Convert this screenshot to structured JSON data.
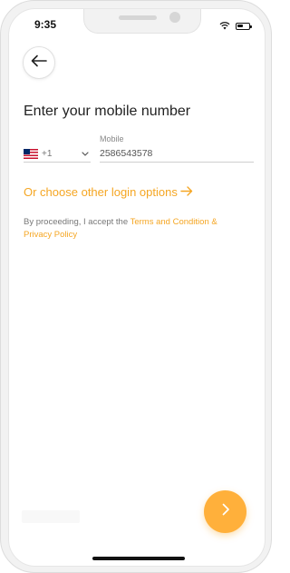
{
  "status_bar": {
    "time": "9:35"
  },
  "header": {
    "back_icon": "arrow-left-icon"
  },
  "form": {
    "title": "Enter your mobile number",
    "country": {
      "flag": "us-flag",
      "code": "+1"
    },
    "mobile": {
      "label": "Mobile",
      "value": "2586543578"
    }
  },
  "links": {
    "other_login": "Or choose other login options"
  },
  "terms": {
    "prefix": "By proceeding, I accept the ",
    "link": "Terms and Condition & Privacy Policy"
  },
  "footer": {
    "next_icon": "chevron-right-icon"
  },
  "colors": {
    "accent": "#f5a623",
    "button": "#ffb03b",
    "text": "#222222"
  }
}
